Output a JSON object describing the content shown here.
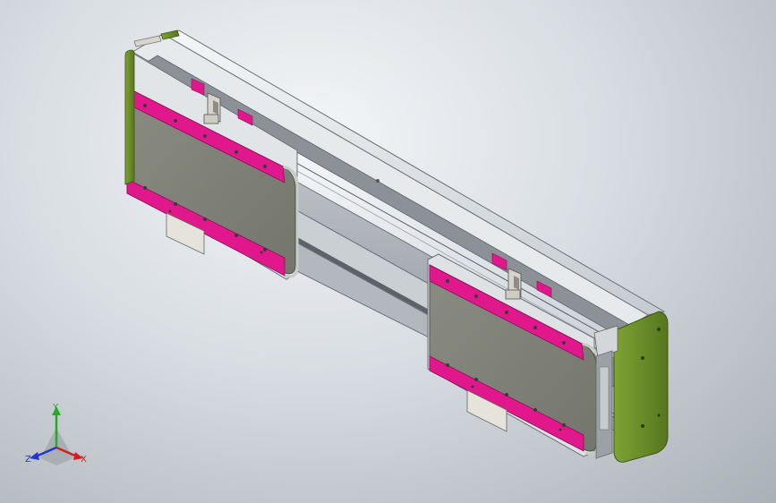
{
  "colors": {
    "frame": "#cfd4d8",
    "frame_dark": "#8c9297",
    "panel": "#7d7f75",
    "panel_light": "#9c9e94",
    "accent": "#e0188c",
    "end_cap": "#6f8f2a",
    "end_cap_dark": "#4e6a1c",
    "bracket": "#d8d6cf",
    "axis_x": "#d0201c",
    "axis_y": "#28a828",
    "axis_z": "#2338c8"
  },
  "triad": {
    "x_label": "X",
    "y_label": "Y",
    "z_label": "Z"
  }
}
